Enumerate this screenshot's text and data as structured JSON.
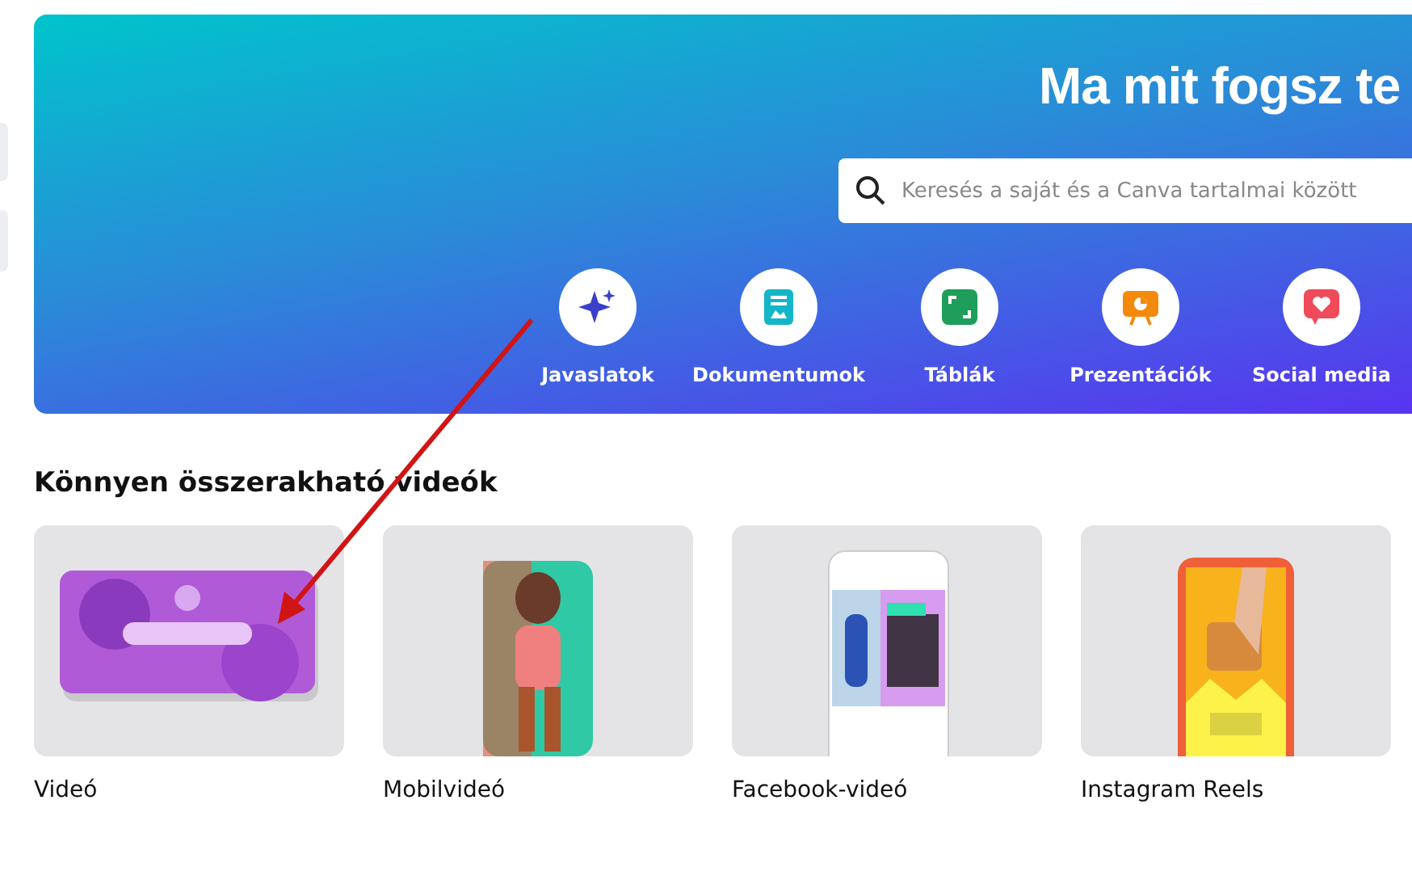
{
  "banner": {
    "title": "Ma mit fogsz te",
    "search": {
      "placeholder": "Keresés a saját és a Canva tartalmai között"
    },
    "categories": [
      {
        "label": "Javaslatok",
        "kind": "sparkle",
        "color": "#3b3fc9"
      },
      {
        "label": "Dokumentumok",
        "kind": "doc",
        "color": "#13b5c8"
      },
      {
        "label": "Táblák",
        "kind": "board",
        "color": "#1e9e5a"
      },
      {
        "label": "Prezentációk",
        "kind": "slides",
        "color": "#f48a0c"
      },
      {
        "label": "Social media",
        "kind": "social",
        "color": "#ef4b5a"
      }
    ]
  },
  "section": {
    "title": "Könnyen összerakható videók",
    "cards": [
      {
        "label": "Videó",
        "kind": "picture"
      },
      {
        "label": "Mobilvideó",
        "kind": "picture"
      },
      {
        "label": "Facebook-videó",
        "kind": "picture"
      },
      {
        "label": "Instagram Reels",
        "kind": "picture"
      }
    ]
  }
}
